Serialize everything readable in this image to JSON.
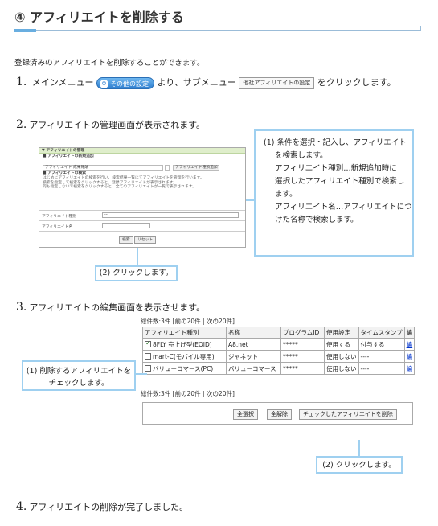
{
  "title": "④ アフィリエイトを削除する",
  "intro": "登録済みのアフィリエイトを削除することができます。",
  "steps": {
    "s1": {
      "num": "1.",
      "pre": "メインメニュー",
      "menu_btn": "その他の設定",
      "mid": "より、サブメニュー",
      "sub_btn": "他社アフィリエイトの設定",
      "post": "をクリックします。"
    },
    "s2": {
      "num": "2.",
      "text": "アフィリエイトの管理画面が表示されます。"
    },
    "s3": {
      "num": "3.",
      "text": "アフィリエイトの編集画面を表示させます。"
    },
    "s4": {
      "num": "4.",
      "text": "アフィリエイトの削除が完了しました。"
    }
  },
  "shot1": {
    "header": "▼ アフィリエイトの管理",
    "new_title": "■ アフィリエイトの新規追加",
    "type_select": "アフィリエイト 成果報酬",
    "add_btn": "アフィリエイト種類追加",
    "search_title": "■ アフィリエイトの検索",
    "note1": "はじめにアフィリエイトの検索を行い、検索結果一覧にてアフィリエイトを管理を行います。",
    "note2": "検索を指定して検索をクリックすると、登録アフィリエイトが表示されます。",
    "note3": "何も指定しないで検索をクリックすると、全てのアフィリエイトが一覧で表示されます。",
    "field1": "アフィリエイト種別",
    "field1_val": "---",
    "field2": "アフィリエイト名",
    "search_btn": "検索",
    "reset_btn": "リセット"
  },
  "callout1": {
    "lines": [
      "(1) 条件を選択・記入し、アフィリエイト",
      "を検索します。",
      "アフィリエイト種別…新規追加時に",
      "選択したアフィリエイト種別で検索し",
      "ます。",
      "アフィリエイト名…アフィリエイトにつ",
      "けた名称で検索します。"
    ]
  },
  "label1": "(2) クリックします。",
  "shot2": {
    "summary": "総件数:3件 [前の20件 | 次の20件]",
    "headers": [
      "アフィリエイト種別",
      "名称",
      "プログラムID",
      "使用設定",
      "タイムスタンプ",
      "編"
    ],
    "rows": [
      {
        "type": "8FLY 売上げ型(EOID)",
        "name": "A8.net",
        "pid": "*****",
        "use": "使用する",
        "ts": "付与する",
        "edit": "編"
      },
      {
        "type": "mart-C(モバイル専用)",
        "name": "ジャネット",
        "pid": "*****",
        "use": "使用しない",
        "ts": "----",
        "edit": "編"
      },
      {
        "type": "バリューコマース(PC)",
        "name": "バリューコマース",
        "pid": "*****",
        "use": "使用しない",
        "ts": "----",
        "edit": "編"
      }
    ],
    "summary2": "総件数:3件 [前の20件 | 次の20件]",
    "btn_all": "全選択",
    "btn_clear": "全解除",
    "btn_delete": "チェックしたアフィリエイトを削除"
  },
  "callout2": {
    "line1": "(1) 削除するアフィリエイトを",
    "line2": "チェックします。"
  },
  "callout3": "(2) クリックします。",
  "colors": {
    "accent": "#69aee0",
    "callout_border": "#9fd0f0",
    "green_header": "#dfeecb"
  }
}
